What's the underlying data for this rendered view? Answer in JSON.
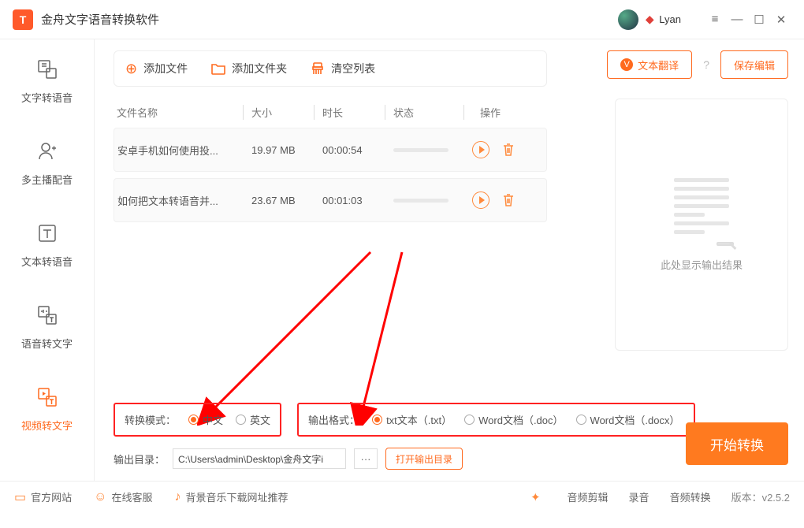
{
  "app": {
    "title": "金舟文字语音转换软件",
    "user": "Lyan"
  },
  "sidebar": {
    "items": [
      {
        "label": "文字转语音"
      },
      {
        "label": "多主播配音"
      },
      {
        "label": "文本转语音"
      },
      {
        "label": "语音转文字"
      },
      {
        "label": "视频转文字"
      }
    ]
  },
  "toolbar": {
    "add_file": "添加文件",
    "add_folder": "添加文件夹",
    "clear": "清空列表"
  },
  "actions": {
    "translate": "文本翻译",
    "save_edit": "保存编辑"
  },
  "table": {
    "head": {
      "name": "文件名称",
      "size": "大小",
      "duration": "时长",
      "status": "状态",
      "op": "操作"
    },
    "rows": [
      {
        "name": "安卓手机如何使用投...",
        "size": "19.97 MB",
        "dur": "00:00:54"
      },
      {
        "name": "如何把文本转语音并...",
        "size": "23.67 MB",
        "dur": "00:01:03"
      }
    ]
  },
  "preview_label": "此处显示输出结果",
  "options": {
    "mode_label": "转换模式：",
    "mode_cn": "中文",
    "mode_en": "英文",
    "format_label": "输出格式：",
    "fmt_txt": "txt文本（.txt）",
    "fmt_doc": "Word文档（.doc）",
    "fmt_docx": "Word文档（.docx）"
  },
  "output": {
    "label": "输出目录：",
    "path": "C:\\Users\\admin\\Desktop\\金舟文字i",
    "open_btn": "打开输出目录"
  },
  "convert_btn": "开始转换",
  "footer": {
    "site": "官方网站",
    "cs": "在线客服",
    "bgm": "背景音乐下载网址推荐",
    "audio_cut": "音频剪辑",
    "record": "录音",
    "audio_conv": "音频转换",
    "version": "版本：v2.5.2"
  }
}
